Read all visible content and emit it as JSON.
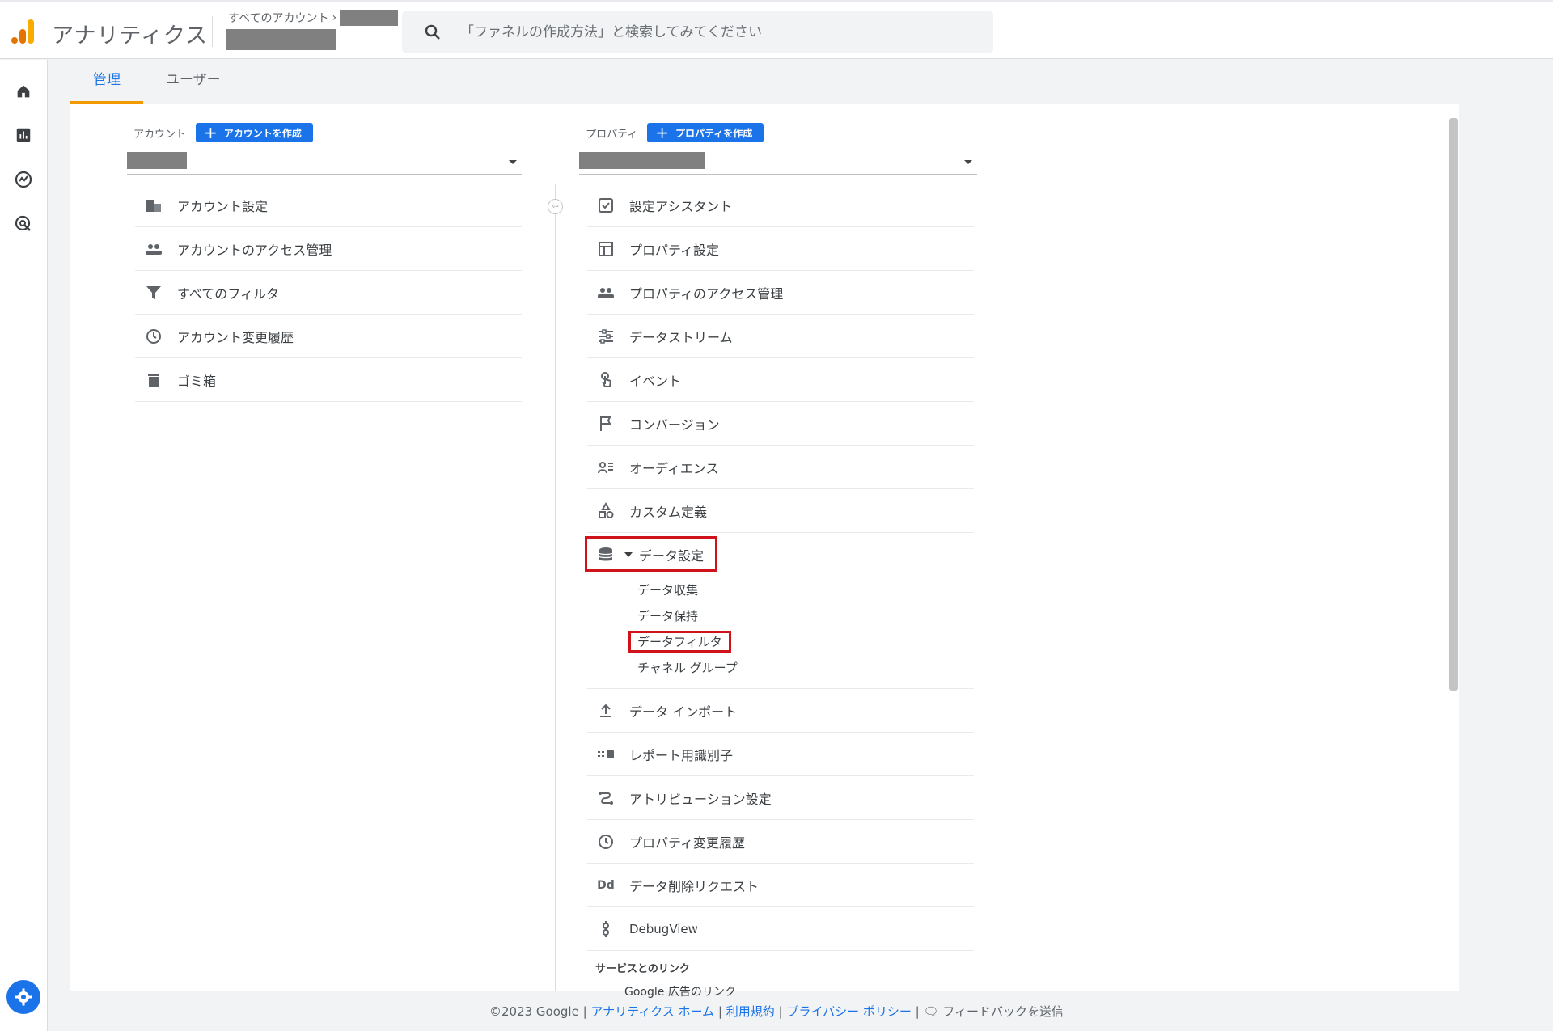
{
  "header": {
    "app_title": "アナリティクス",
    "breadcrumb_all": "すべてのアカウント",
    "search_placeholder": "「ファネルの作成方法」と検索してみてください"
  },
  "tabs": [
    {
      "label": "管理",
      "active": true
    },
    {
      "label": "ユーザー",
      "active": false
    }
  ],
  "account": {
    "label": "アカウント",
    "create_label": "アカウントを作成",
    "items": [
      {
        "label": "アカウント設定",
        "icon": "building-icon"
      },
      {
        "label": "アカウントのアクセス管理",
        "icon": "people-icon"
      },
      {
        "label": "すべてのフィルタ",
        "icon": "filter-icon"
      },
      {
        "label": "アカウント変更履歴",
        "icon": "history-icon"
      },
      {
        "label": "ゴミ箱",
        "icon": "trash-icon"
      }
    ]
  },
  "property": {
    "label": "プロパティ",
    "create_label": "プロパティを作成",
    "items": [
      {
        "label": "設定アシスタント",
        "icon": "checkbox-icon"
      },
      {
        "label": "プロパティ設定",
        "icon": "layout-icon"
      },
      {
        "label": "プロパティのアクセス管理",
        "icon": "people-icon"
      },
      {
        "label": "データストリーム",
        "icon": "stream-icon"
      },
      {
        "label": "イベント",
        "icon": "touch-icon"
      },
      {
        "label": "コンバージョン",
        "icon": "flag-icon"
      },
      {
        "label": "オーディエンス",
        "icon": "audience-icon"
      },
      {
        "label": "カスタム定義",
        "icon": "shapes-icon"
      },
      {
        "label": "データ設定",
        "icon": "database-icon"
      },
      {
        "label": "データ インポート",
        "icon": "upload-icon"
      },
      {
        "label": "レポート用識別子",
        "icon": "identifier-icon"
      },
      {
        "label": "アトリビューション設定",
        "icon": "attribution-icon"
      },
      {
        "label": "プロパティ変更履歴",
        "icon": "history-icon"
      },
      {
        "label": "データ削除リクエスト",
        "icon": "dd-icon"
      },
      {
        "label": "DebugView",
        "icon": "debug-icon"
      }
    ],
    "data_settings_sub": [
      "データ収集",
      "データ保持",
      "データフィルタ",
      "チャネル グループ"
    ],
    "section_links": "サービスとのリンク",
    "cut_item": "Google 広告のリンク"
  },
  "footer": {
    "copyright": "©2023 Google |",
    "analytics_home": "アナリティクス ホーム",
    "terms": "利用規約",
    "privacy": "プライバシー ポリシー",
    "feedback": "フィードバックを送信",
    "sep": "|"
  }
}
